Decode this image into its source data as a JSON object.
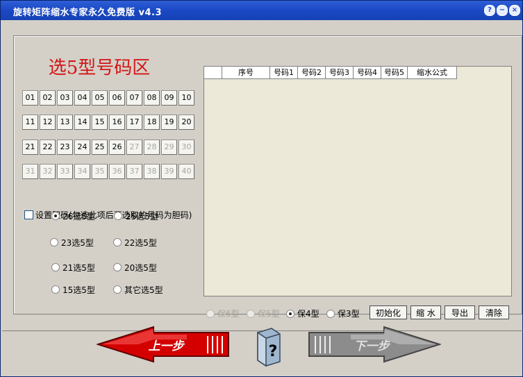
{
  "window": {
    "title": "旋转矩阵缩水专家永久免费版 v4.3",
    "help": "?",
    "minimize": "−",
    "close": "×"
  },
  "area": {
    "title": "选5型号码区"
  },
  "numbers": [
    {
      "label": "01",
      "enabled": true
    },
    {
      "label": "02",
      "enabled": true
    },
    {
      "label": "03",
      "enabled": true
    },
    {
      "label": "04",
      "enabled": true
    },
    {
      "label": "05",
      "enabled": true
    },
    {
      "label": "06",
      "enabled": true
    },
    {
      "label": "07",
      "enabled": true
    },
    {
      "label": "08",
      "enabled": true
    },
    {
      "label": "09",
      "enabled": true
    },
    {
      "label": "10",
      "enabled": true
    },
    {
      "label": "11",
      "enabled": true
    },
    {
      "label": "12",
      "enabled": true
    },
    {
      "label": "13",
      "enabled": true
    },
    {
      "label": "14",
      "enabled": true
    },
    {
      "label": "15",
      "enabled": true
    },
    {
      "label": "16",
      "enabled": true
    },
    {
      "label": "17",
      "enabled": true
    },
    {
      "label": "18",
      "enabled": true
    },
    {
      "label": "19",
      "enabled": true
    },
    {
      "label": "20",
      "enabled": true
    },
    {
      "label": "21",
      "enabled": true
    },
    {
      "label": "22",
      "enabled": true
    },
    {
      "label": "23",
      "enabled": true
    },
    {
      "label": "24",
      "enabled": true
    },
    {
      "label": "25",
      "enabled": true
    },
    {
      "label": "26",
      "enabled": true
    },
    {
      "label": "27",
      "enabled": false
    },
    {
      "label": "28",
      "enabled": false
    },
    {
      "label": "29",
      "enabled": false
    },
    {
      "label": "30",
      "enabled": false
    },
    {
      "label": "31",
      "enabled": false
    },
    {
      "label": "32",
      "enabled": false
    },
    {
      "label": "33",
      "enabled": false
    },
    {
      "label": "34",
      "enabled": false
    },
    {
      "label": "35",
      "enabled": false
    },
    {
      "label": "36",
      "enabled": false
    },
    {
      "label": "37",
      "enabled": false
    },
    {
      "label": "38",
      "enabled": false
    },
    {
      "label": "39",
      "enabled": false
    },
    {
      "label": "40",
      "enabled": false
    }
  ],
  "dan_checkbox": {
    "label": "设置胆码(勾选此项后再选取的号码为胆码)",
    "checked": false
  },
  "types": [
    {
      "label": "26选5型",
      "selected": true
    },
    {
      "label": "25选5型",
      "selected": false
    },
    {
      "label": "23选5型",
      "selected": false
    },
    {
      "label": "22选5型",
      "selected": false
    },
    {
      "label": "21选5型",
      "selected": false
    },
    {
      "label": "20选5型",
      "selected": false
    },
    {
      "label": "15选5型",
      "selected": false
    },
    {
      "label": "其它选5型",
      "selected": false
    }
  ],
  "grid": {
    "columns": [
      "",
      "序号",
      "号码1",
      "号码2",
      "号码3",
      "号码4",
      "号码5",
      "缩水公式"
    ]
  },
  "guarantee": [
    {
      "label": "保6型",
      "selected": false,
      "enabled": false
    },
    {
      "label": "保5型",
      "selected": false,
      "enabled": false
    },
    {
      "label": "保4型",
      "selected": true,
      "enabled": true
    },
    {
      "label": "保3型",
      "selected": false,
      "enabled": true
    }
  ],
  "actions": {
    "init": "初始化",
    "shrink": "缩 水",
    "export": "导出",
    "clear": "清除"
  },
  "nav": {
    "prev": "上一步",
    "next": "下一步",
    "help_icon": "?"
  },
  "colors": {
    "title_bar": "#1b48c4",
    "area_title": "#d41515",
    "prev_arrow": "#d40000",
    "next_arrow": "#8c8c8c"
  }
}
